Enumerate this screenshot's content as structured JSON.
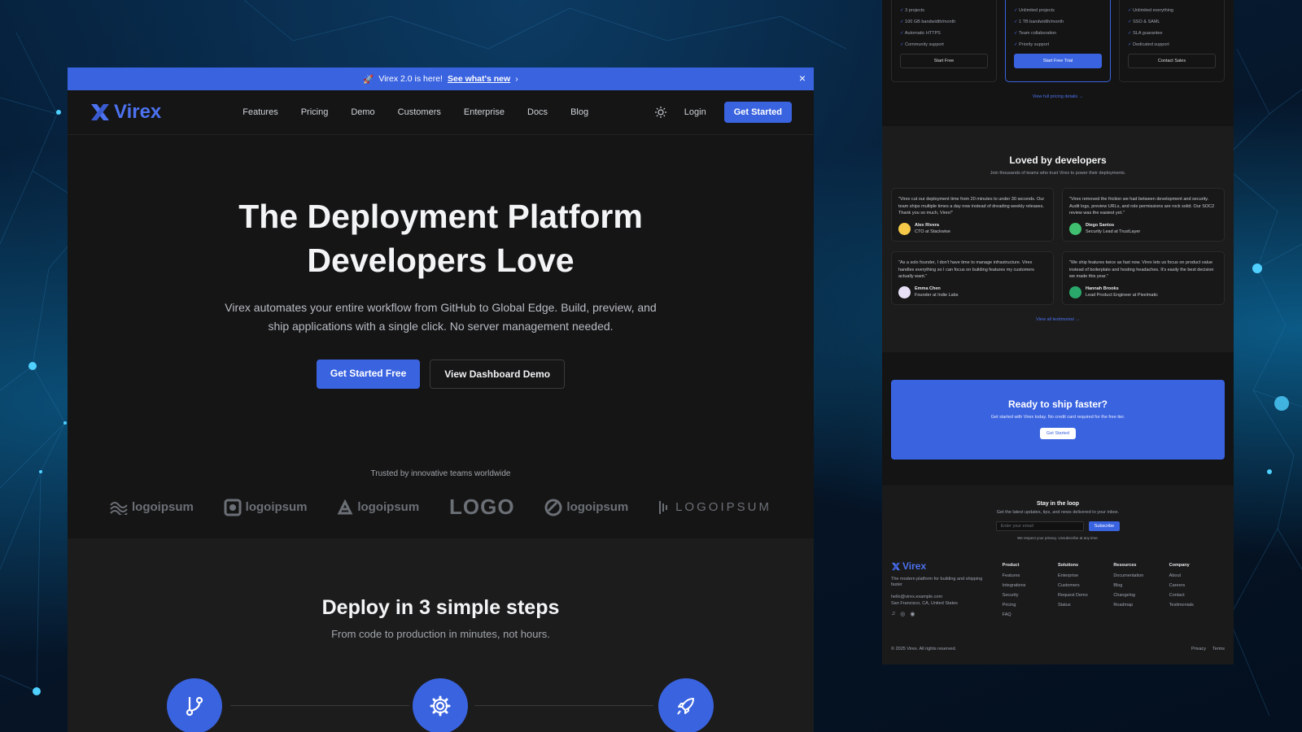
{
  "banner": {
    "emoji": "🚀",
    "text": "Virex 2.0 is here!",
    "link": "See what's new",
    "close": "×"
  },
  "nav": {
    "logo": "Virex",
    "menu": [
      "Features",
      "Pricing",
      "Demo",
      "Customers",
      "Enterprise",
      "Docs",
      "Blog"
    ],
    "login": "Login",
    "cta": "Get Started"
  },
  "hero": {
    "title_line1": "The Deployment Platform",
    "title_line2": "Developers Love",
    "desc_line1": "Virex automates your entire workflow from GitHub to Global Edge. Build, preview, and",
    "desc_line2": "ship applications with a single click. No server management needed.",
    "primary": "Get Started Free",
    "secondary": "View Dashboard Demo"
  },
  "trusted": {
    "label": "Trusted by innovative teams worldwide",
    "logos": [
      "logoipsum",
      "logoipsum",
      "logoipsum",
      "LOGO",
      "logoipsum",
      "LOGOIPSUM"
    ]
  },
  "steps": {
    "title": "Deploy in 3 simple steps",
    "subtitle": "From code to production in minutes, not hours."
  },
  "pricing": {
    "plans": [
      {
        "features": [
          "3 projects",
          "100 GB bandwidth/month",
          "Automatic HTTPS",
          "Community support"
        ],
        "button": "Start Free"
      },
      {
        "features": [
          "Unlimited projects",
          "1 TB bandwidth/month",
          "Team collaboration",
          "Priority support"
        ],
        "button": "Start Free Trial"
      },
      {
        "features": [
          "Unlimited everything",
          "SSO & SAML",
          "SLA guarantee",
          "Dedicated support"
        ],
        "button": "Contact Sales"
      }
    ],
    "link": "View full pricing details →"
  },
  "testimonials": {
    "title": "Loved by developers",
    "subtitle": "Join thousands of teams who trust Virex to power their deployments.",
    "items": [
      {
        "quote": "\"Virex cut our deployment time from 20 minutes to under 30 seconds. Our team ships multiple times a day now instead of dreading weekly releases. Thank you so much, Virex!\"",
        "name": "Alex Rivera",
        "role": "CTO at Stackwise",
        "color": "#f7c948"
      },
      {
        "quote": "\"Virex removed the friction we had between development and security. Audit logs, preview URLs, and role permissions are rock solid. Our SOC2 review was the easiest yet.\"",
        "name": "Diego Santos",
        "role": "Security Lead at TrustLayer",
        "color": "#3fbf6f"
      },
      {
        "quote": "\"As a solo founder, I don't have time to manage infrastructure. Virex handles everything so I can focus on building features my customers actually want.\"",
        "name": "Emma Chen",
        "role": "Founder at Indie Labs",
        "color": "#e8e0f7"
      },
      {
        "quote": "\"We ship features twice as fast now. Virex lets us focus on product value instead of boilerplate and hosting headaches. It's easily the best decision we made this year.\"",
        "name": "Hannah Brooks",
        "role": "Lead Product Engineer at Pixelmatic",
        "color": "#2aa86b"
      }
    ],
    "link": "View all testimonial →"
  },
  "cta": {
    "title": "Ready to ship faster?",
    "text": "Get started with Virex today. No credit card required for the free tier.",
    "button": "Get Started"
  },
  "newsletter": {
    "title": "Stay in the loop",
    "text": "Get the latest updates, tips, and news delivered to your inbox.",
    "placeholder": "Enter your email",
    "button": "Subscribe",
    "note": "We respect your privacy. Unsubscribe at any time."
  },
  "footer": {
    "logo": "Virex",
    "tagline": "The modern platform for building and shipping faster",
    "email": "hello@virex.example.com",
    "location": "San Francisco, CA, United States",
    "columns": [
      {
        "title": "Product",
        "links": [
          "Features",
          "Integrations",
          "Security",
          "Pricing",
          "FAQ"
        ]
      },
      {
        "title": "Solutions",
        "links": [
          "Enterprise",
          "Customers",
          "Request Demo",
          "Status"
        ]
      },
      {
        "title": "Resources",
        "links": [
          "Documentation",
          "Blog",
          "Changelog",
          "Roadmap"
        ]
      },
      {
        "title": "Company",
        "links": [
          "About",
          "Careers",
          "Contact",
          "Testimonials"
        ]
      }
    ],
    "copyright": "© 2025 Virex. All rights reserved.",
    "privacy": "Privacy",
    "terms": "Terms"
  },
  "colors": {
    "accent": "#3a63e0",
    "bg": "#151515"
  }
}
